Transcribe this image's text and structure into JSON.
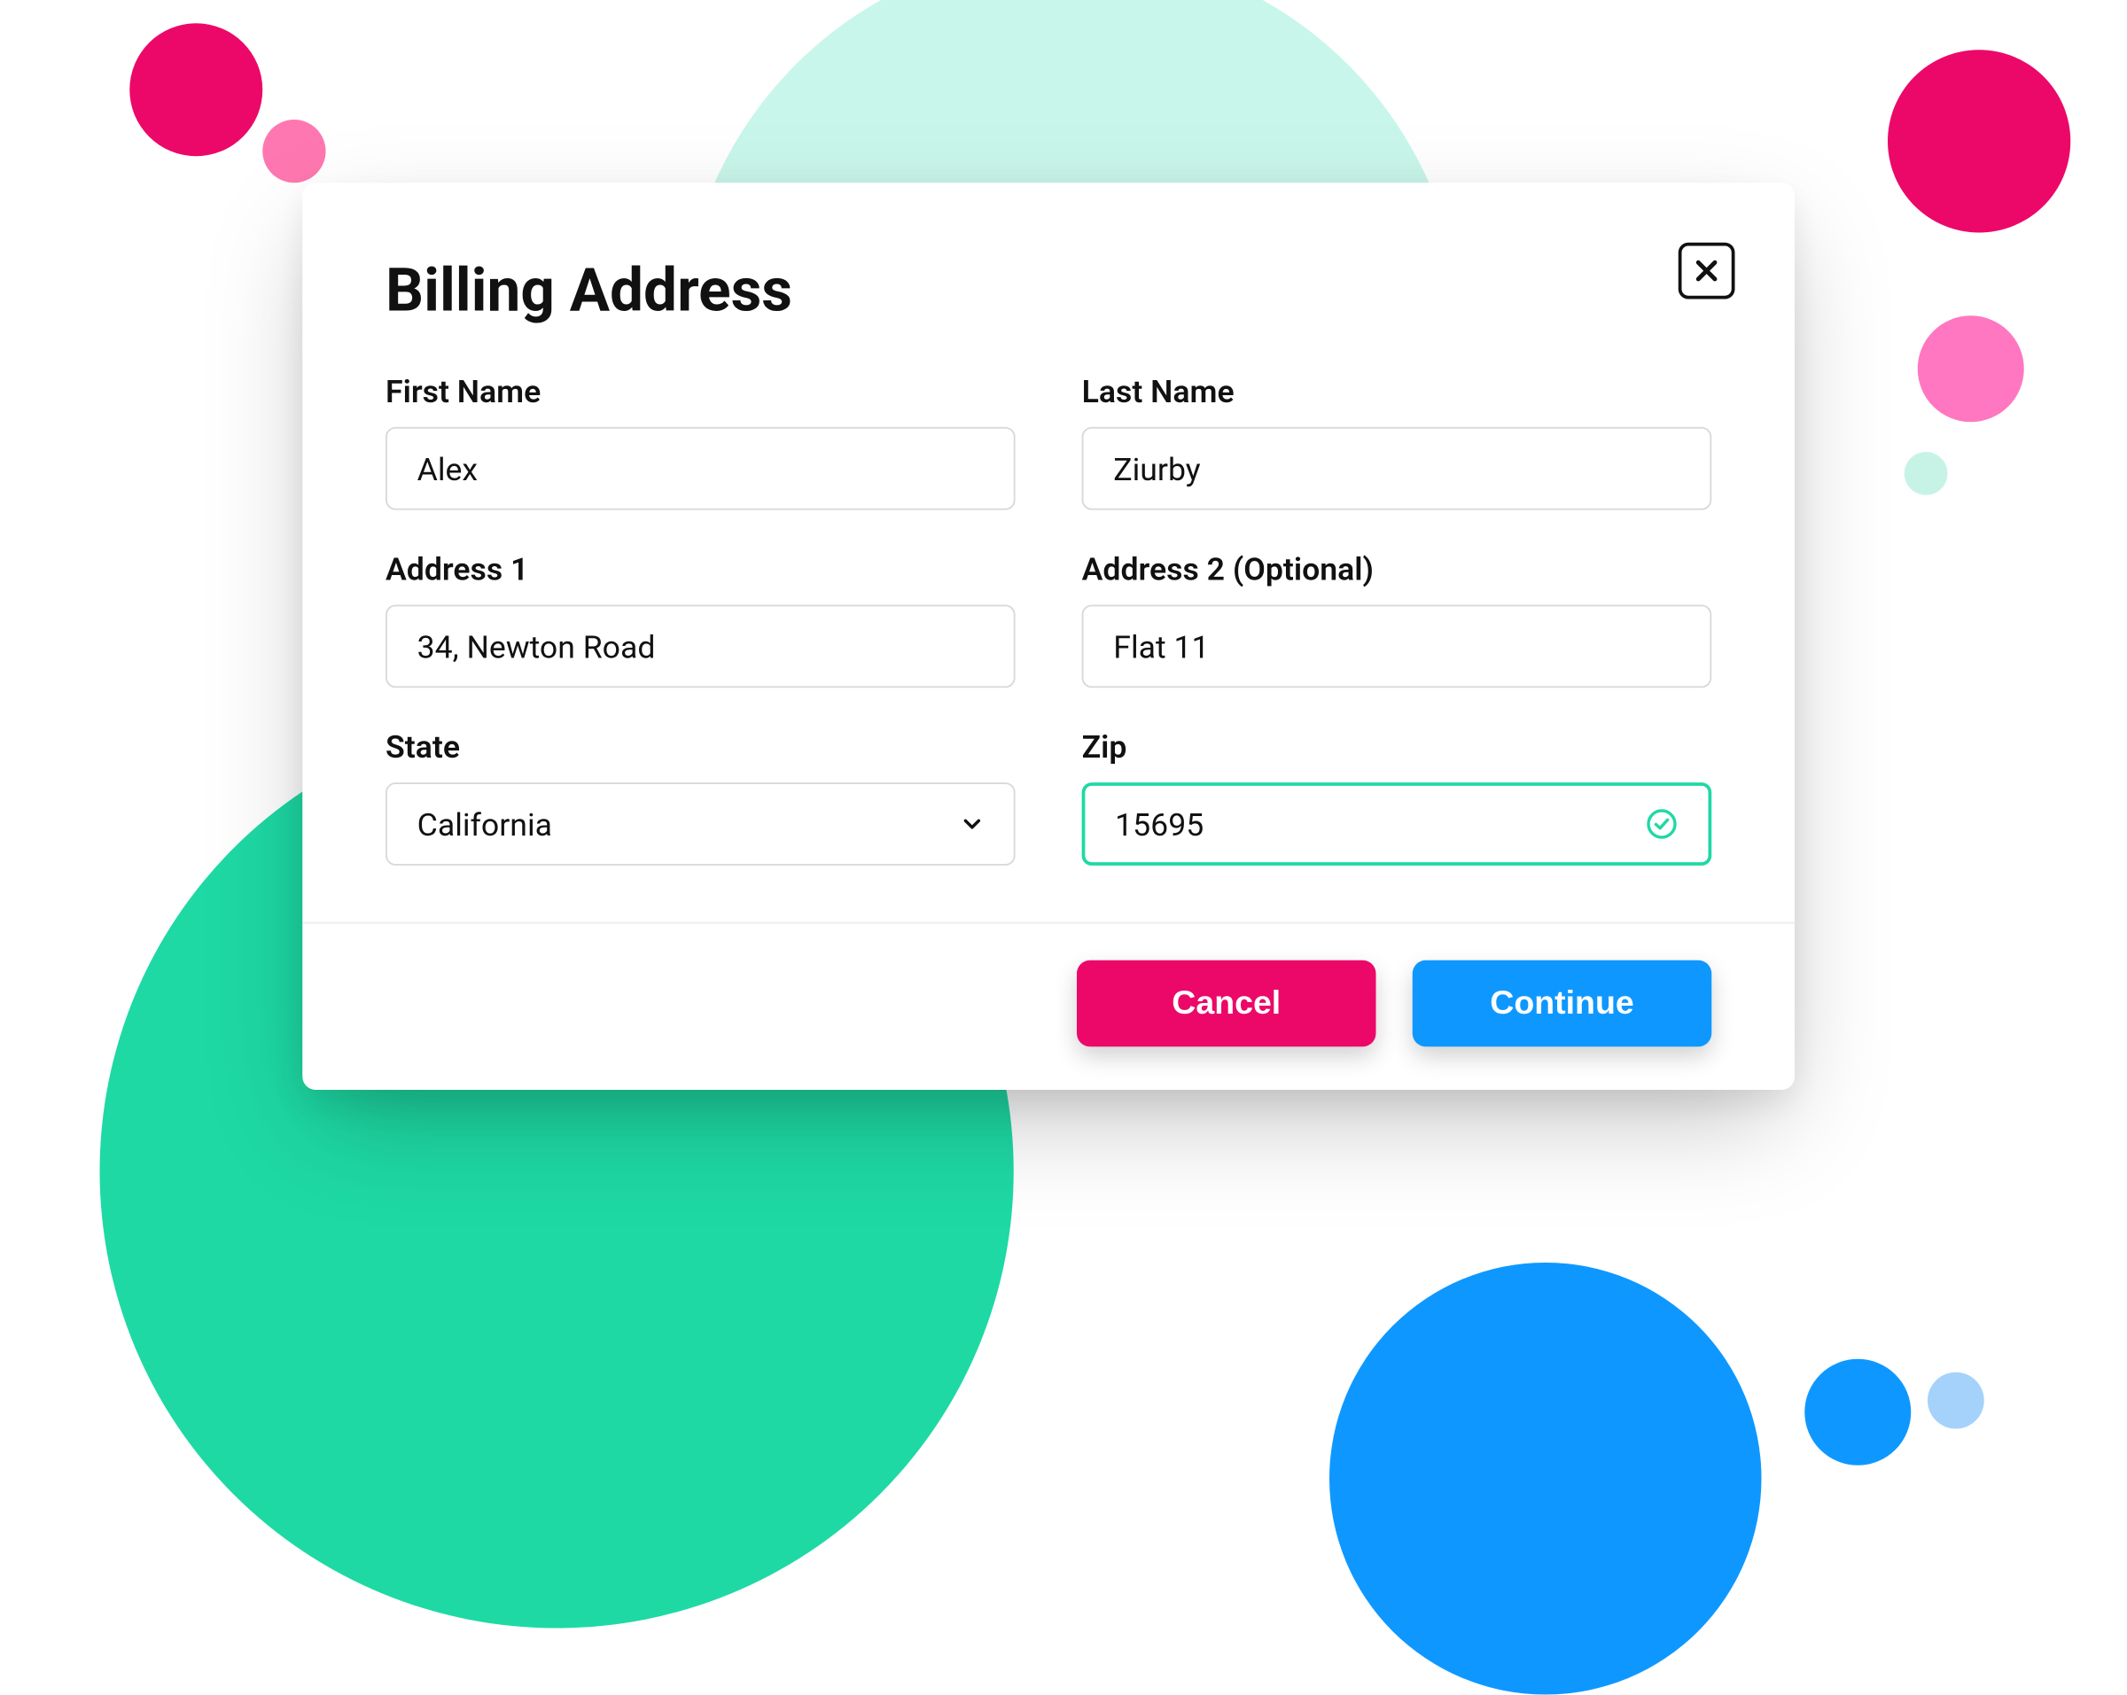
{
  "modal": {
    "title": "Billing Address",
    "fields": {
      "first_name": {
        "label": "First Name",
        "value": "Alex"
      },
      "last_name": {
        "label": "Last Name",
        "value": "Ziurby"
      },
      "address1": {
        "label": "Address 1",
        "value": "34, Newton Road"
      },
      "address2": {
        "label": "Address 2 (Optional)",
        "value": "Flat 11"
      },
      "state": {
        "label": "State",
        "value": "California"
      },
      "zip": {
        "label": "Zip",
        "value": "15695"
      }
    },
    "actions": {
      "cancel": "Cancel",
      "continue": "Continue"
    }
  },
  "colors": {
    "accent_teal": "#1ed9a4",
    "accent_pink": "#ec0868",
    "accent_blue": "#0e98ff"
  }
}
